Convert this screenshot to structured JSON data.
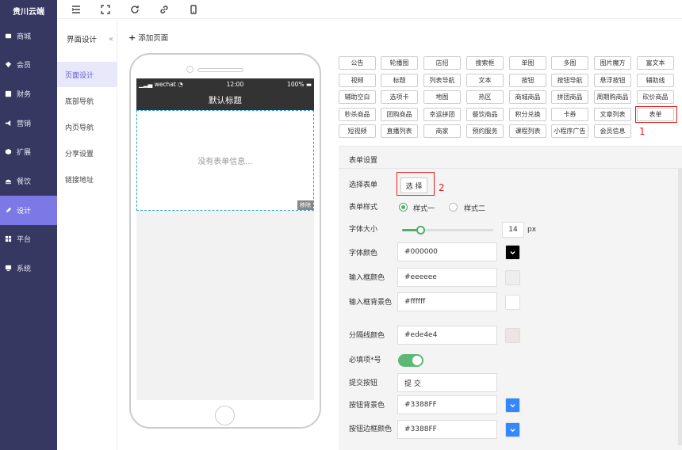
{
  "brand": "贵川云端",
  "sidebar": {
    "items": [
      {
        "label": "商城",
        "icon": "shop-icon"
      },
      {
        "label": "会员",
        "icon": "member-icon"
      },
      {
        "label": "财务",
        "icon": "finance-icon"
      },
      {
        "label": "营销",
        "icon": "marketing-icon"
      },
      {
        "label": "扩展",
        "icon": "extend-icon"
      },
      {
        "label": "餐饮",
        "icon": "food-icon"
      },
      {
        "label": "设计",
        "icon": "design-icon"
      },
      {
        "label": "平台",
        "icon": "platform-icon"
      },
      {
        "label": "系统",
        "icon": "system-icon"
      }
    ],
    "active": "设计",
    "accent": "#7c78e6",
    "bg": "#363862"
  },
  "toolbar": {
    "icons": [
      "menu-icon",
      "fullscreen-icon",
      "refresh-icon",
      "link-icon",
      "mobile-icon"
    ]
  },
  "subnav": {
    "title": "界面设计",
    "collapse": "«",
    "items": [
      "页面设计",
      "底部导航",
      "内页导航",
      "分享设置",
      "链接地址"
    ],
    "active": "页面设计"
  },
  "add_page": {
    "plus": "+",
    "label": "添加页面"
  },
  "phone": {
    "status_left": "wechat",
    "status_time": "12:00",
    "status_right": "100%",
    "title": "默认标题",
    "empty_text": "没有表单信息...",
    "remove_label": "移除"
  },
  "components": [
    "公告",
    "轮播图",
    "店招",
    "搜索框",
    "单图",
    "多图",
    "图片魔方",
    "富文本",
    "视频",
    "标题",
    "列表导航",
    "文本",
    "按钮",
    "按钮导航",
    "悬浮按钮",
    "辅助线",
    "辅助空白",
    "选项卡",
    "地图",
    "热区",
    "商城商品",
    "拼团商品",
    "周期购商品",
    "砍价商品",
    "秒杀商品",
    "团购商品",
    "幸运拼团",
    "餐饮商品",
    "积分兑换",
    "卡券",
    "文章列表",
    "表单",
    "短视频",
    "直播列表",
    "商家",
    "预约服务",
    "课程列表",
    "小程序广告",
    "会员信息"
  ],
  "annotations": {
    "one": "1",
    "two": "2"
  },
  "settings": {
    "title": "表单设置",
    "select_form": {
      "label": "选择表单",
      "button": "选 择"
    },
    "form_style": {
      "label": "表单样式",
      "options": [
        "样式一",
        "样式二"
      ],
      "selected": 0
    },
    "font_size": {
      "label": "字体大小",
      "value": "14",
      "unit": "px",
      "min": 0,
      "max": 100,
      "level": 0.2
    },
    "font_color": {
      "label": "字体颜色",
      "value": "#000000",
      "swatch": "#000000"
    },
    "input_border_color": {
      "label": "输入框颜色",
      "value": "#eeeeee",
      "swatch": "#eeeeee"
    },
    "input_bg_color": {
      "label": "输入框背景色",
      "value": "#ffffff",
      "swatch": "#ffffff"
    },
    "divider_color": {
      "label": "分隔线颜色",
      "value": "#ede4e4",
      "swatch": "#ede4e4"
    },
    "required_mark": {
      "label": "必填项*号",
      "on": true
    },
    "submit_button": {
      "label": "提交按钮",
      "value": "提 交"
    },
    "button_bg_color": {
      "label": "按钮背景色",
      "value": "#3388FF",
      "swatch": "#3388FF"
    },
    "button_border_color": {
      "label": "按钮边框颜色",
      "value": "#3388FF",
      "swatch": "#3388FF"
    }
  }
}
